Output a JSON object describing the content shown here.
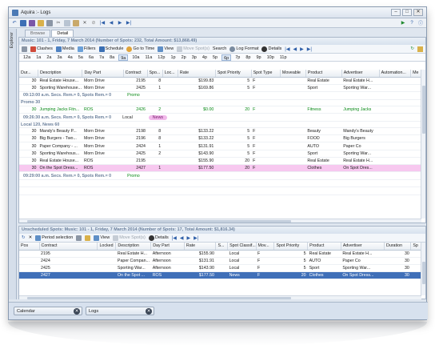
{
  "app": {
    "title": "Aquira :- Logs",
    "window_buttons": [
      "–",
      "□",
      "✕"
    ],
    "explorer_label": "Explorer"
  },
  "main_toolbar": {
    "icons": [
      "undo-icon",
      "save-icon",
      "save-all-icon",
      "open-icon",
      "print-icon",
      "cut-icon",
      "copy-icon",
      "paste-icon",
      "delete-icon",
      "close-icon",
      "cancel-icon",
      "first-icon",
      "prev-icon",
      "next-icon",
      "last-icon"
    ],
    "right_icons": [
      "forward-icon",
      "help-icon",
      "info-icon"
    ]
  },
  "tabs": [
    {
      "label": "Browse",
      "active": false
    },
    {
      "label": "Detail",
      "active": true
    }
  ],
  "top_panel": {
    "info": "Music: 101 - 1, Friday, 7 March 2014 (Number of Spots: 232, Total Amount: $13,868.49)",
    "toolbar": [
      {
        "label": "",
        "icon": "print-icon"
      },
      {
        "label": "Clashes",
        "icon": "clash-icon"
      },
      {
        "label": "Media",
        "icon": "media-icon"
      },
      {
        "label": "Fillers",
        "icon": "fillers-icon"
      },
      {
        "label": "Schedule",
        "icon": "schedule-icon"
      },
      {
        "label": "Go to Time",
        "icon": "clock-icon"
      },
      {
        "label": "View",
        "icon": "view-icon"
      },
      {
        "label": "Move Spot(s)",
        "icon": "move-icon",
        "disabled": true
      },
      {
        "label": "Search",
        "icon": ""
      },
      {
        "label": "Log Format",
        "icon": "format-icon"
      },
      {
        "label": "Details",
        "icon": "details-icon"
      }
    ],
    "hours": [
      "12a",
      "1a",
      "2a",
      "3a",
      "4a",
      "5a",
      "6a",
      "7a",
      "8a",
      "9a",
      "10a",
      "11a",
      "12p",
      "1p",
      "2p",
      "3p",
      "4p",
      "5p",
      "6p",
      "7p",
      "8p",
      "9p",
      "10p",
      "11p"
    ],
    "selected_hours": [
      "9a",
      "6p"
    ],
    "columns": [
      "Dur...",
      "Description",
      "Day Part",
      "Contract",
      "Spo...",
      "Loc...",
      "Rate",
      "Spot Priority",
      "Spot Type",
      "Moveable",
      "Product",
      "Advertiser",
      "Automation...",
      "Me"
    ],
    "groups": [
      {
        "header": "",
        "rows": [
          {
            "dur": "30",
            "desc": "Real Estate House...",
            "daypart": "Morn Drive",
            "contract": "2195",
            "spot": "8",
            "loc": "",
            "rate": "$199.83",
            "priority": "5",
            "type": "F",
            "moveable": "",
            "product": "Real Estate",
            "advertiser": "Real Estate H...",
            "style": ""
          },
          {
            "dur": "30",
            "desc": "Sporting Warehouse...",
            "daypart": "Morn Drive",
            "contract": "2425",
            "spot": "1",
            "loc": "",
            "rate": "$169.86",
            "priority": "5",
            "type": "F",
            "moveable": "",
            "product": "Sport",
            "advertiser": "Sporting War...",
            "style": ""
          }
        ]
      },
      {
        "header": "09:13:00 a.m.   Secs. Rem.= 0,   Spots Rem.= 0",
        "promo": "Promo",
        "subheader": "Promo 30",
        "rows": [
          {
            "dur": "30",
            "desc": "Jumping Jacks Fitn...",
            "daypart": "ROS",
            "contract": "2426",
            "spot": "2",
            "loc": "",
            "rate": "$0.00",
            "priority": "20",
            "type": "F",
            "moveable": "",
            "product": "Fitness",
            "advertiser": "Jumping Jacks",
            "style": "green"
          }
        ]
      },
      {
        "header": "09:26:30 a.m.   Secs. Rem.= 0,   Spots Rem.= 0",
        "local": "Local",
        "news": "News",
        "subheader": "Local 120, News 60",
        "rows": [
          {
            "dur": "30",
            "desc": "Mandy's Beauty P...",
            "daypart": "Morn Drive",
            "contract": "2198",
            "spot": "8",
            "loc": "",
            "rate": "$133.22",
            "priority": "5",
            "type": "F",
            "moveable": "",
            "product": "Beauty",
            "advertiser": "Mandy's Beauty",
            "style": ""
          },
          {
            "dur": "30",
            "desc": "Big Burgers - Two...",
            "daypart": "Morn Drive",
            "contract": "2196",
            "spot": "8",
            "loc": "",
            "rate": "$133.22",
            "priority": "5",
            "type": "F",
            "moveable": "",
            "product": "FOOD",
            "advertiser": "Big Burgers",
            "style": ""
          },
          {
            "dur": "30",
            "desc": "Paper Company - ...",
            "daypart": "Morn Drive",
            "contract": "2424",
            "spot": "1",
            "loc": "",
            "rate": "$131.91",
            "priority": "5",
            "type": "F",
            "moveable": "",
            "product": "AUTO",
            "advertiser": "Paper Co",
            "style": ""
          },
          {
            "dur": "30",
            "desc": "Sporting Warehous...",
            "daypart": "Morn Drive",
            "contract": "2425",
            "spot": "2",
            "loc": "",
            "rate": "$143.90",
            "priority": "5",
            "type": "F",
            "moveable": "",
            "product": "Sport",
            "advertiser": "Sporting War...",
            "style": ""
          },
          {
            "dur": "30",
            "desc": "Real Estate House...",
            "daypart": "ROS",
            "contract": "2195",
            "spot": "",
            "loc": "",
            "rate": "$155.90",
            "priority": "20",
            "type": "F",
            "moveable": "",
            "product": "Real Estate",
            "advertiser": "Real Estate H...",
            "style": ""
          },
          {
            "dur": "30",
            "desc": "On the Spot Dress...",
            "daypart": "ROS",
            "contract": "2427",
            "spot": "1",
            "loc": "",
            "rate": "$177.50",
            "priority": "20",
            "type": "F",
            "moveable": "",
            "product": "Clothes",
            "advertiser": "On Spot Dres...",
            "style": "pink"
          }
        ]
      },
      {
        "header": "09:29:00 a.m.   Secs. Rem.= 0,   Spots Rem.= 0",
        "promo": "Promo",
        "rows": []
      }
    ]
  },
  "bottom_panel": {
    "info": "Unscheduled Spots: Music: 101 - 1, Friday, 7 March 2014 (Number of Spots: 17, Total Amount: $1,816.34)",
    "toolbar": [
      {
        "label": "",
        "icon": "refresh-icon"
      },
      {
        "label": "",
        "icon": "delete-icon"
      },
      {
        "label": "Period selection",
        "icon": "period-icon"
      },
      {
        "label": "",
        "icon": "print-icon"
      },
      {
        "label": "",
        "icon": "lock-icon"
      },
      {
        "label": "View",
        "icon": "view-icon"
      },
      {
        "label": "Move Spot(s)",
        "icon": "move-icon",
        "disabled": true
      },
      {
        "label": "Details",
        "icon": "details-icon"
      }
    ],
    "columns": [
      "Pos",
      "Contract",
      "Locked",
      "Description",
      "Day Part",
      "Rate",
      "S...",
      "Spot Classif...",
      "Mov...",
      "Spot Priority",
      "Product",
      "Advertiser",
      "Duration",
      "Sp"
    ],
    "rows": [
      {
        "pos": "",
        "contract": "2195",
        "locked": "",
        "desc": "Real Estate H...",
        "daypart": "Afternoon",
        "rate": "$155.90",
        "s": "",
        "classif": "Local",
        "mov": "F",
        "priority": "5",
        "product": "Real Estate",
        "advertiser": "Real Estate H...",
        "duration": "30",
        "style": ""
      },
      {
        "pos": "",
        "contract": "2424",
        "locked": "",
        "desc": "Paper Compan...",
        "daypart": "Afternoon",
        "rate": "$131.91",
        "s": "",
        "classif": "Local",
        "mov": "F",
        "priority": "5",
        "product": "AUTO",
        "advertiser": "Paper Co",
        "duration": "30",
        "style": ""
      },
      {
        "pos": "",
        "contract": "2425",
        "locked": "",
        "desc": "Sporting War...",
        "daypart": "Afternoon",
        "rate": "$143.90",
        "s": "",
        "classif": "Local",
        "mov": "F",
        "priority": "5",
        "product": "Sport",
        "advertiser": "Sporting War...",
        "duration": "30",
        "style": ""
      },
      {
        "pos": "",
        "contract": "2427",
        "locked": "",
        "desc": "On the Spot ...",
        "daypart": "ROS",
        "rate": "$177.50",
        "s": "",
        "classif": "News",
        "mov": "F",
        "priority": "20",
        "product": "Clothes",
        "advertiser": "On Spot Dress...",
        "duration": "30",
        "style": "sel"
      }
    ]
  },
  "doc_tabs": [
    {
      "label": "Calendar"
    },
    {
      "label": "Logs"
    }
  ],
  "colors": {
    "pink_row": "#f7c8ef",
    "selected_row": "#3f6fb8",
    "promo_green": "#0a8a18",
    "news_badge": "#f1b9ea"
  }
}
